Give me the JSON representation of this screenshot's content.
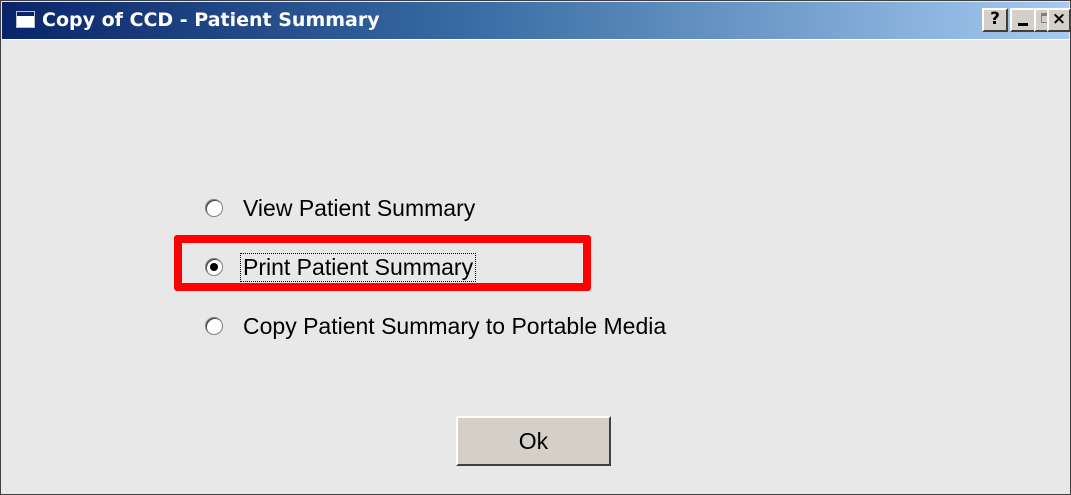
{
  "window": {
    "title": "Copy of CCD - Patient Summary",
    "controls": {
      "help_label": "?",
      "close_label": "×"
    }
  },
  "options": [
    {
      "label": "View Patient Summary",
      "selected": false
    },
    {
      "label": "Print Patient Summary",
      "selected": true
    },
    {
      "label": "Copy Patient Summary to Portable Media",
      "selected": false
    }
  ],
  "ok_button": {
    "label": "Ok"
  },
  "colors": {
    "highlight": "#ff0000",
    "titlebar_start": "#0a246a",
    "titlebar_end": "#a6caf0",
    "background": "#e8e8e8"
  }
}
